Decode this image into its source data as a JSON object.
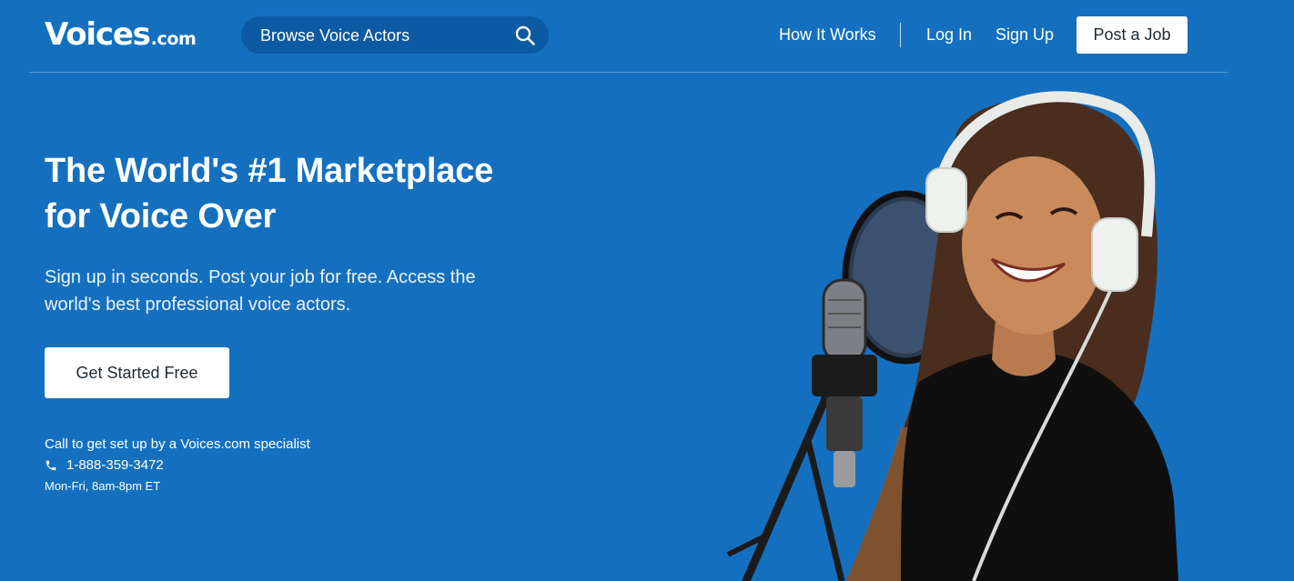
{
  "header": {
    "logo_main": "Voices",
    "logo_tld": ".com",
    "search_label": "Browse Voice Actors",
    "search_icon": "search-icon",
    "nav": {
      "how_it_works": "How It Works",
      "log_in": "Log In",
      "sign_up": "Sign Up",
      "post_job": "Post a Job"
    }
  },
  "hero": {
    "title_line1": "The World's #1 Marketplace",
    "title_line2": "for Voice Over",
    "subtitle_line1": "Sign up in seconds. Post your job for free. Access the",
    "subtitle_line2": "world's best professional voice actors.",
    "cta_label": "Get Started Free",
    "call_text": "Call to get set up by a Voices.com specialist",
    "phone_icon": "phone-icon",
    "phone_number": "1-888-359-3472",
    "hours": "Mon-Fri, 8am-8pm ET"
  },
  "colors": {
    "background": "#1470bf",
    "search_pill": "#0b5aa3",
    "button_bg": "#ffffff",
    "button_text": "#1f2a33"
  }
}
